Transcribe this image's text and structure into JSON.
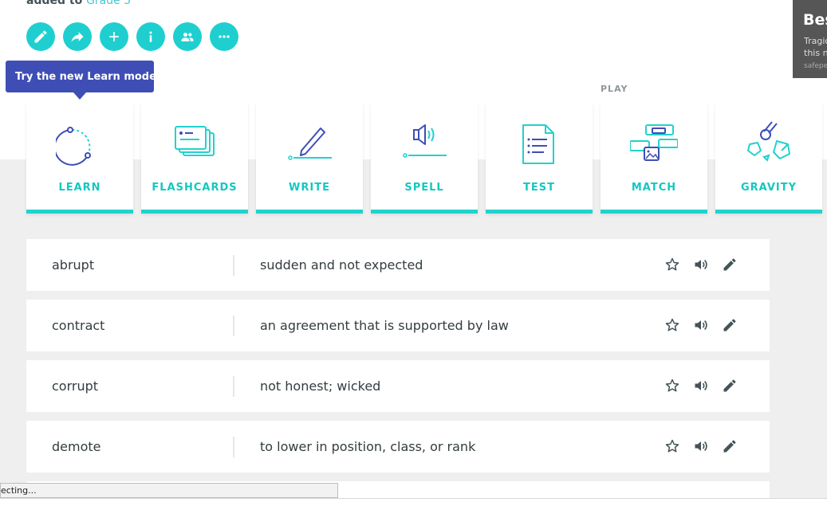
{
  "header": {
    "added_to_text": "added to",
    "class_link": "Grade 5"
  },
  "actions": [
    {
      "name": "edit-button",
      "icon": "pencil-icon"
    },
    {
      "name": "share-button",
      "icon": "share-arrow-icon"
    },
    {
      "name": "add-button",
      "icon": "plus-icon"
    },
    {
      "name": "info-button",
      "icon": "info-icon"
    },
    {
      "name": "people-button",
      "icon": "people-icon"
    },
    {
      "name": "more-button",
      "icon": "more-icon"
    }
  ],
  "tooltip": {
    "text": "Try the new Learn mode!"
  },
  "play_label": "PLAY",
  "modes": [
    {
      "label": "LEARN",
      "icon": "learn-icon"
    },
    {
      "label": "FLASHCARDS",
      "icon": "flashcards-icon"
    },
    {
      "label": "WRITE",
      "icon": "write-icon"
    },
    {
      "label": "SPELL",
      "icon": "spell-icon"
    },
    {
      "label": "TEST",
      "icon": "test-icon"
    },
    {
      "label": "MATCH",
      "icon": "match-icon"
    },
    {
      "label": "GRAVITY",
      "icon": "gravity-icon"
    }
  ],
  "terms": [
    {
      "word": "abrupt",
      "definition": "sudden and not expected"
    },
    {
      "word": "contract",
      "definition": "an agreement that is supported by law"
    },
    {
      "word": "corrupt",
      "definition": "not honest; wicked"
    },
    {
      "word": "demote",
      "definition": "to lower in position, class, or rank"
    }
  ],
  "ad": {
    "title": "Bes",
    "line1": "Tragic",
    "line2": "this n",
    "source": "safepe"
  },
  "status_bar": {
    "text": "ecting..."
  },
  "colors": {
    "accent": "#1fcfcf",
    "tooltip": "#3f4eb5",
    "mode_label": "#15c7c1",
    "learn_icon": "#3f4eb5"
  }
}
